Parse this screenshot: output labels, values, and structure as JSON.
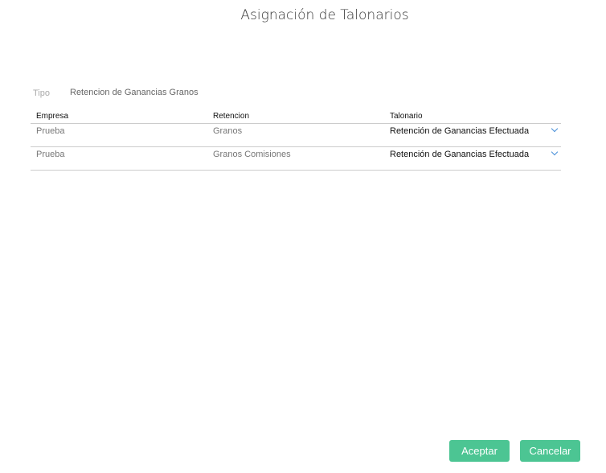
{
  "title": "Asignación de Talonarios",
  "tipo": {
    "label": "Tipo",
    "value": "Retencion de Ganancias Granos"
  },
  "table": {
    "headers": [
      "Empresa",
      "Retencion",
      "Talonario"
    ],
    "rows": [
      {
        "empresa": "Prueba",
        "retencion": "Granos",
        "talonario": "Retención de Ganancias Efectuada"
      },
      {
        "empresa": "Prueba",
        "retencion": "Granos Comisiones",
        "talonario": "Retención de Ganancias Efectuada"
      }
    ]
  },
  "buttons": {
    "accept": "Aceptar",
    "cancel": "Cancelar"
  }
}
